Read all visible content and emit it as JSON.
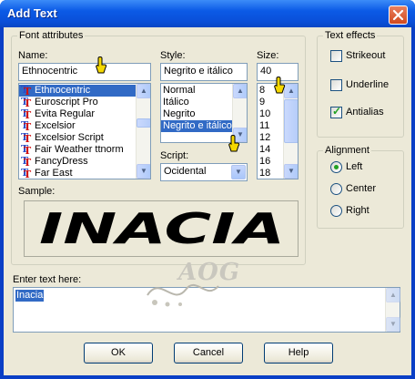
{
  "window": {
    "title": "Add Text"
  },
  "font_attributes": {
    "legend": "Font attributes",
    "name_label": "Name:",
    "name_value": "Ethnocentric",
    "fonts": [
      "Ethnocentric",
      "Euroscript Pro",
      "Evita Regular",
      "Excelsior",
      "Excelsior Script",
      "Fair Weather ttnorm",
      "FancyDress",
      "Far East"
    ],
    "style_label": "Style:",
    "style_value": "Negrito e itálico",
    "styles": [
      "Normal",
      "Itálico",
      "Negrito",
      "Negrito e itálico"
    ],
    "size_label": "Size:",
    "size_value": "40",
    "sizes": [
      "8",
      "9",
      "10",
      "11",
      "12",
      "14",
      "16",
      "18"
    ],
    "script_label": "Script:",
    "script_value": "Ocidental",
    "sample_label": "Sample:",
    "sample_text": "INACIA"
  },
  "text_effects": {
    "legend": "Text effects",
    "strikeout": "Strikeout",
    "underline": "Underline",
    "antialias": "Antialias"
  },
  "alignment": {
    "legend": "Alignment",
    "left": "Left",
    "center": "Center",
    "right": "Right"
  },
  "enter_text": {
    "label": "Enter text here:",
    "value": "Inacia"
  },
  "watermark": "AOG",
  "buttons": {
    "ok": "OK",
    "cancel": "Cancel",
    "help": "Help"
  }
}
